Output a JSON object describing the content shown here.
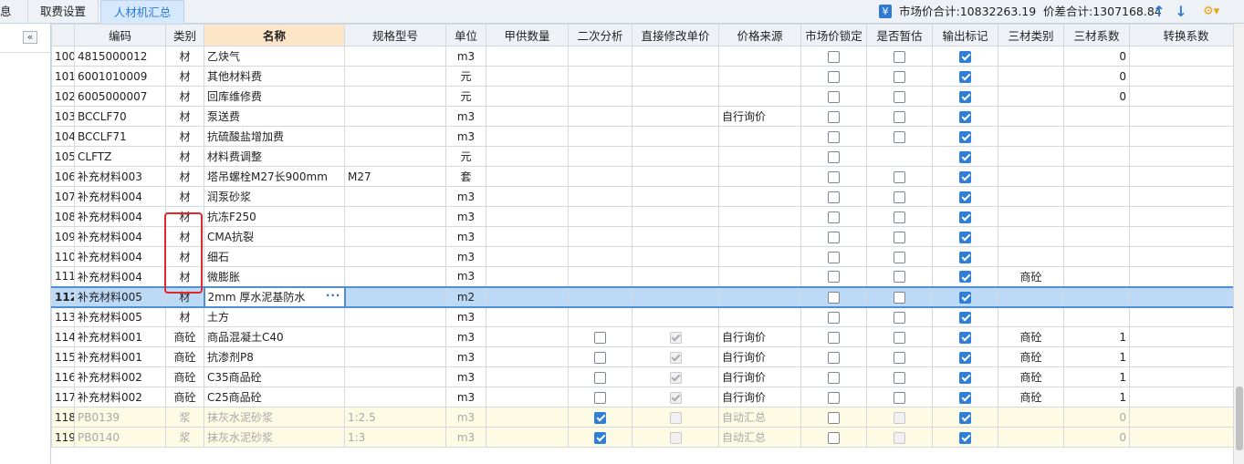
{
  "tabs": [
    {
      "label": "息",
      "active": false
    },
    {
      "label": "取费设置",
      "active": false
    },
    {
      "label": "人材机汇总",
      "active": true
    }
  ],
  "summary": {
    "market_label": "市场价合计:10832263.19",
    "diff_label": "价差合计:1307168.84"
  },
  "columns": [
    "",
    "编码",
    "类别",
    "名称",
    "规格型号",
    "单位",
    "甲供数量",
    "二次分析",
    "直接修改单价",
    "价格来源",
    "市场价锁定",
    "是否暂估",
    "输出标记",
    "三材类别",
    "三材系数",
    "转换系数"
  ],
  "rows": [
    {
      "no": "100",
      "code": "4815000012",
      "cat": "材",
      "name": "乙炔气",
      "spec": "",
      "unit": "m3",
      "supply": "",
      "analysis": null,
      "modify": null,
      "source": "",
      "lock": false,
      "est": false,
      "out": true,
      "mat": "",
      "coef": "0",
      "conv": ""
    },
    {
      "no": "101",
      "code": "6001010009",
      "cat": "材",
      "name": "其他材料费",
      "spec": "",
      "unit": "元",
      "supply": "",
      "analysis": null,
      "modify": null,
      "source": "",
      "lock": false,
      "est": false,
      "out": true,
      "mat": "",
      "coef": "0",
      "conv": ""
    },
    {
      "no": "102",
      "code": "6005000007",
      "cat": "材",
      "name": "回库维修费",
      "spec": "",
      "unit": "元",
      "supply": "",
      "analysis": null,
      "modify": null,
      "source": "",
      "lock": false,
      "est": false,
      "out": true,
      "mat": "",
      "coef": "0",
      "conv": ""
    },
    {
      "no": "103",
      "code": "BCCLF70",
      "cat": "材",
      "name": "泵送费",
      "spec": "",
      "unit": "m3",
      "supply": "",
      "analysis": null,
      "modify": null,
      "source": "自行询价",
      "lock": false,
      "est": false,
      "out": true,
      "mat": "",
      "coef": "",
      "conv": ""
    },
    {
      "no": "104",
      "code": "BCCLF71",
      "cat": "材",
      "name": "抗硫酸盐增加费",
      "spec": "",
      "unit": "m3",
      "supply": "",
      "analysis": null,
      "modify": null,
      "source": "",
      "lock": false,
      "est": false,
      "out": true,
      "mat": "",
      "coef": "",
      "conv": ""
    },
    {
      "no": "105",
      "code": "CLFTZ",
      "cat": "材",
      "name": "材料费调整",
      "spec": "",
      "unit": "元",
      "supply": "",
      "analysis": null,
      "modify": null,
      "source": "",
      "lock": false,
      "est": null,
      "out": true,
      "mat": "",
      "coef": "",
      "conv": ""
    },
    {
      "no": "106",
      "code": "补充材料003",
      "cat": "材",
      "name": "塔吊螺栓M27长900mm",
      "spec": "M27",
      "unit": "套",
      "supply": "",
      "analysis": null,
      "modify": null,
      "source": "",
      "lock": false,
      "est": false,
      "out": true,
      "mat": "",
      "coef": "",
      "conv": ""
    },
    {
      "no": "107",
      "code": "补充材料004",
      "cat": "材",
      "name": "润泵砂浆",
      "spec": "",
      "unit": "m3",
      "supply": "",
      "analysis": null,
      "modify": null,
      "source": "",
      "lock": false,
      "est": false,
      "out": true,
      "mat": "",
      "coef": "",
      "conv": ""
    },
    {
      "no": "108",
      "code": "补充材料004",
      "cat": "材",
      "name": "抗冻F250",
      "spec": "",
      "unit": "m3",
      "supply": "",
      "analysis": null,
      "modify": null,
      "source": "",
      "lock": false,
      "est": false,
      "out": true,
      "mat": "",
      "coef": "",
      "conv": ""
    },
    {
      "no": "109",
      "code": "补充材料004",
      "cat": "材",
      "name": "CMA抗裂",
      "spec": "",
      "unit": "m3",
      "supply": "",
      "analysis": null,
      "modify": null,
      "source": "",
      "lock": false,
      "est": false,
      "out": true,
      "mat": "",
      "coef": "",
      "conv": ""
    },
    {
      "no": "110",
      "code": "补充材料004",
      "cat": "材",
      "name": "细石",
      "spec": "",
      "unit": "m3",
      "supply": "",
      "analysis": null,
      "modify": null,
      "source": "",
      "lock": false,
      "est": false,
      "out": true,
      "mat": "",
      "coef": "",
      "conv": ""
    },
    {
      "no": "111",
      "code": "补充材料004",
      "cat": "材",
      "name": "微膨胀",
      "spec": "",
      "unit": "m3",
      "supply": "",
      "analysis": null,
      "modify": null,
      "source": "",
      "lock": false,
      "est": false,
      "out": true,
      "mat": "商砼",
      "coef": "",
      "conv": ""
    },
    {
      "no": "112",
      "code": "补充材料005",
      "cat": "材",
      "name": "2mm 厚水泥基防水",
      "spec": "",
      "unit": "m2",
      "supply": "",
      "analysis": null,
      "modify": null,
      "source": "",
      "lock": false,
      "est": false,
      "out": true,
      "mat": "",
      "coef": "",
      "conv": ""
    },
    {
      "no": "113",
      "code": "补充材料005",
      "cat": "材",
      "name": "土方",
      "spec": "",
      "unit": "m3",
      "supply": "",
      "analysis": null,
      "modify": null,
      "source": "",
      "lock": false,
      "est": false,
      "out": true,
      "mat": "",
      "coef": "",
      "conv": ""
    },
    {
      "no": "114",
      "code": "补充材料001",
      "cat": "商砼",
      "name": "商品混凝土C40",
      "spec": "",
      "unit": "m3",
      "supply": "",
      "analysis": false,
      "modify": true,
      "source": "自行询价",
      "lock": false,
      "est": false,
      "out": true,
      "mat": "商砼",
      "coef": "1",
      "conv": ""
    },
    {
      "no": "115",
      "code": "补充材料001",
      "cat": "商砼",
      "name": "抗渗剂P8",
      "spec": "",
      "unit": "m3",
      "supply": "",
      "analysis": false,
      "modify": true,
      "source": "自行询价",
      "lock": false,
      "est": false,
      "out": true,
      "mat": "商砼",
      "coef": "1",
      "conv": ""
    },
    {
      "no": "116",
      "code": "补充材料002",
      "cat": "商砼",
      "name": "C35商品砼",
      "spec": "",
      "unit": "m3",
      "supply": "",
      "analysis": false,
      "modify": true,
      "source": "自行询价",
      "lock": false,
      "est": false,
      "out": true,
      "mat": "商砼",
      "coef": "1",
      "conv": ""
    },
    {
      "no": "117",
      "code": "补充材料002",
      "cat": "商砼",
      "name": "C25商品砼",
      "spec": "",
      "unit": "m3",
      "supply": "",
      "analysis": false,
      "modify": true,
      "source": "自行询价",
      "lock": false,
      "est": false,
      "out": true,
      "mat": "商砼",
      "coef": "1",
      "conv": ""
    },
    {
      "no": "118",
      "code": "PB0139",
      "cat": "浆",
      "name": "抹灰水泥砂浆",
      "spec": "1:2.5",
      "unit": "m3",
      "supply": "",
      "analysis": true,
      "modify": false,
      "source": "自动汇总",
      "lock": false,
      "est": false,
      "out": true,
      "mat": "",
      "coef": "0",
      "conv": ""
    },
    {
      "no": "119",
      "code": "PB0140",
      "cat": "浆",
      "name": "抹灰水泥砂浆",
      "spec": "1:3",
      "unit": "m3",
      "supply": "",
      "analysis": true,
      "modify": false,
      "source": "自动汇总",
      "lock": false,
      "est": false,
      "out": true,
      "mat": "",
      "coef": "0",
      "conv": ""
    }
  ],
  "selected_row": "112",
  "icons": {
    "sum": "summary-icon",
    "up": "arrow-up-icon",
    "down": "arrow-down-icon",
    "gear": "settings-icon",
    "collapse": "collapse-icon",
    "more": "ellipsis-icon"
  },
  "colors": {
    "accent": "#2f7fd8",
    "header_name": "#fde6c7",
    "selected": "#bcd9f6",
    "highlight": "#e02828",
    "yellow_row": "#fdfbe3"
  }
}
